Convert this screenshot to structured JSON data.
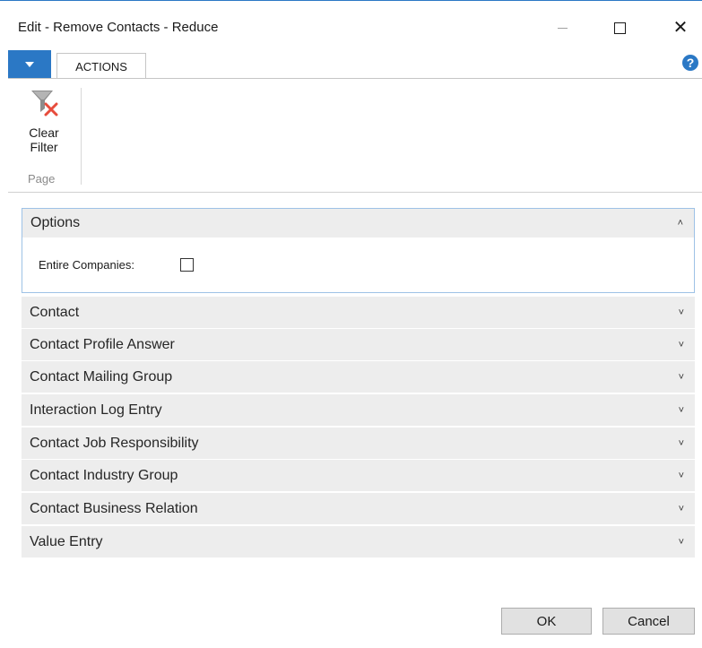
{
  "window": {
    "title": "Edit - Remove Contacts - Reduce",
    "controls": [
      "minimize-icon",
      "maximize-icon",
      "close-icon"
    ],
    "close_glyph": "✕"
  },
  "ribbon": {
    "tabs": [
      {
        "label": "ACTIONS"
      }
    ],
    "help_glyph": "?",
    "actions": [
      {
        "label_line1": "Clear",
        "label_line2": "Filter",
        "icon": "clear-filter-icon"
      }
    ],
    "group_label": "Page"
  },
  "options": {
    "header": "Options",
    "chevron": "˄",
    "fields": [
      {
        "label": "Entire Companies:",
        "checked": false
      }
    ]
  },
  "fasttabs": [
    {
      "label": "Contact"
    },
    {
      "label": "Contact Profile Answer"
    },
    {
      "label": "Contact Mailing Group"
    },
    {
      "label": "Interaction Log Entry"
    },
    {
      "label": "Contact Job Responsibility"
    },
    {
      "label": "Contact Industry Group"
    },
    {
      "label": "Contact Business Relation"
    },
    {
      "label": "Value Entry"
    }
  ],
  "fasttab_chevron": "˅",
  "buttons": {
    "ok": "OK",
    "cancel": "Cancel"
  },
  "colors": {
    "accent": "#2b78c5",
    "fasttab_bg": "#ededed",
    "clear_filter_x": "#e74c3c"
  }
}
